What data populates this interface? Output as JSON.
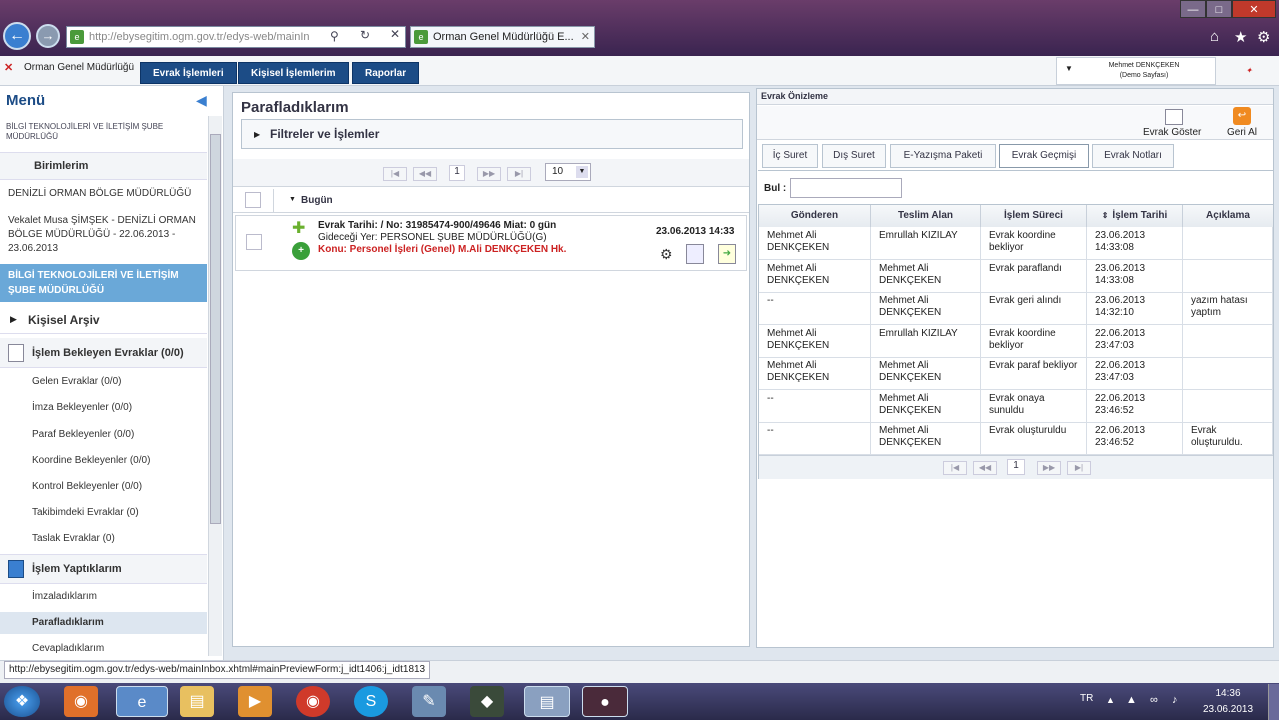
{
  "browser": {
    "url": "http://ebysegitim.ogm.gov.tr/edys-web/mainIn",
    "url_domain": "ebysegitim.ogm.gov.tr",
    "tab_title": "Orman Genel Müdürlüğü E...",
    "page_tab_title": "Orman Genel Müdürlüğü",
    "status_url": "http://ebysegitim.ogm.gov.tr/edys-web/mainInbox.xhtml#mainPreviewForm:j_idt1406:j_idt1813"
  },
  "topmenu": [
    "Evrak İşlemleri",
    "Kişisel İşlemlerim",
    "Raporlar"
  ],
  "user": {
    "name": "Mehmet DENKÇEKEN",
    "subtitle": "(Demo Sayfası)"
  },
  "sidebar": {
    "title": "Menü",
    "org": "BİLGİ TEKNOLOJİLERİ VE İLETİŞİM ŞUBE MÜDÜRLÜĞÜ",
    "units_header": "Birimlerim",
    "units": [
      "DENİZLİ ORMAN BÖLGE MÜDÜRLÜĞÜ",
      "Vekalet Musa ŞİMŞEK - DENİZLİ ORMAN BÖLGE MÜDÜRLÜĞÜ - 22.06.2013 - 23.06.2013",
      "BİLGİ TEKNOLOJİLERİ VE İLETİŞİM ŞUBE MÜDÜRLÜĞÜ"
    ],
    "archive": "Kişisel Arşiv",
    "pending_header": "İşlem Bekleyen Evraklar (0/0)",
    "pending_items": [
      "Gelen Evraklar (0/0)",
      "İmza Bekleyenler (0/0)",
      "Paraf Bekleyenler (0/0)",
      "Koordine Bekleyenler (0/0)",
      "Kontrol Bekleyenler (0/0)",
      "Takibimdeki Evraklar (0)",
      "Taslak Evraklar (0)"
    ],
    "done_header": "İşlem Yaptıklarım",
    "done_items": [
      "İmzaladıklarım",
      "Parafladıklarım",
      "Cevapladıklarım"
    ]
  },
  "middle": {
    "title": "Parafladıklarım",
    "filter_label": "Filtreler ve İşlemler",
    "page_number": "1",
    "page_size": "10",
    "group_label": "Bugün",
    "doc": {
      "line1": "Evrak Tarihi: / No: 31985474-900/49646 Miat: 0 gün",
      "line2": "Gideceği Yer: PERSONEL ŞUBE MÜDÜRLÜĞÜ(G)",
      "line3": "Konu: Personel İşleri (Genel) M.Ali DENKÇEKEN Hk.",
      "datetime": "23.06.2013 14:33"
    }
  },
  "preview": {
    "title": "Evrak Önizleme",
    "show_button": "Evrak Göster",
    "recall_button": "Geri Al",
    "tabs": [
      "İç Suret",
      "Dış Suret",
      "E-Yazışma Paketi",
      "Evrak Geçmişi",
      "Evrak Notları"
    ],
    "search_label": "Bul :",
    "columns": [
      "Gönderen",
      "Teslim Alan",
      "İşlem Süreci",
      "İşlem Tarihi",
      "Açıklama"
    ],
    "rows": [
      [
        "Mehmet Ali DENKÇEKEN",
        "Emrullah KIZILAY",
        "Evrak koordine bekliyor",
        "23.06.2013 14:33:08",
        ""
      ],
      [
        "Mehmet Ali DENKÇEKEN",
        "Mehmet Ali DENKÇEKEN",
        "Evrak paraflandı",
        "23.06.2013 14:33:08",
        ""
      ],
      [
        "--",
        "Mehmet Ali DENKÇEKEN",
        "Evrak geri alındı",
        "23.06.2013 14:32:10",
        "yazım hatası yaptım"
      ],
      [
        "Mehmet Ali DENKÇEKEN",
        "Emrullah KIZILAY",
        "Evrak koordine bekliyor",
        "22.06.2013 23:47:03",
        ""
      ],
      [
        "Mehmet Ali DENKÇEKEN",
        "Mehmet Ali DENKÇEKEN",
        "Evrak paraf bekliyor",
        "22.06.2013 23:47:03",
        ""
      ],
      [
        "--",
        "Mehmet Ali DENKÇEKEN",
        "Evrak onaya sunuldu",
        "22.06.2013 23:46:52",
        ""
      ],
      [
        "--",
        "Mehmet Ali DENKÇEKEN",
        "Evrak oluşturuldu",
        "22.06.2013 23:46:52",
        "Evrak oluşturuldu."
      ]
    ],
    "page_number": "1"
  },
  "taskbar": {
    "lang": "TR",
    "time": "14:36",
    "date": "23.06.2013"
  },
  "colors": {
    "menu_blue": "#1c4c86",
    "selected_blue": "#6aa8d8",
    "link_red": "#cc2222"
  }
}
